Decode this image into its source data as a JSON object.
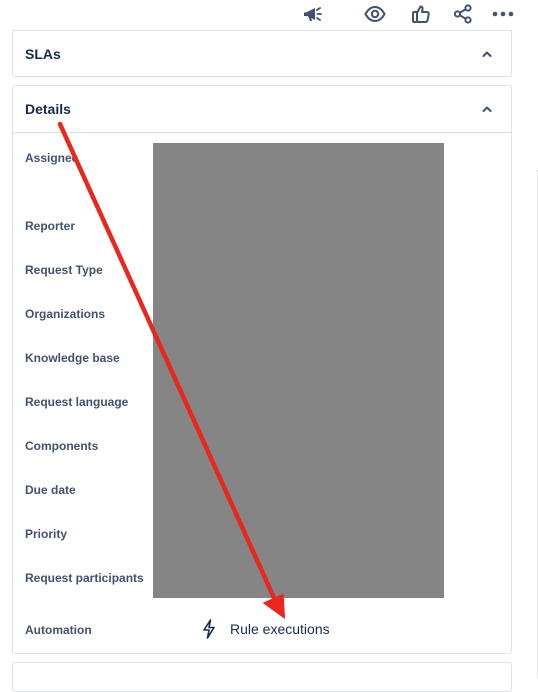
{
  "toolbar": {
    "icons": [
      "megaphone-icon",
      "eye-icon",
      "thumbs-up-icon",
      "share-icon",
      "more-icon"
    ]
  },
  "slas": {
    "title": "SLAs",
    "icon": "chevron-up-icon"
  },
  "details": {
    "title": "Details",
    "icon": "chevron-up-icon",
    "fields": [
      "Assignee",
      "Reporter",
      "Request Type",
      "Organizations",
      "Knowledge base",
      "Request language",
      "Components",
      "Due date",
      "Priority",
      "Request participants",
      "Automation"
    ],
    "automation_value": "Rule executions",
    "automation_icon": "lightning-bolt-icon"
  },
  "annotation": {
    "color": "#e8271e",
    "shape": "arrow"
  }
}
